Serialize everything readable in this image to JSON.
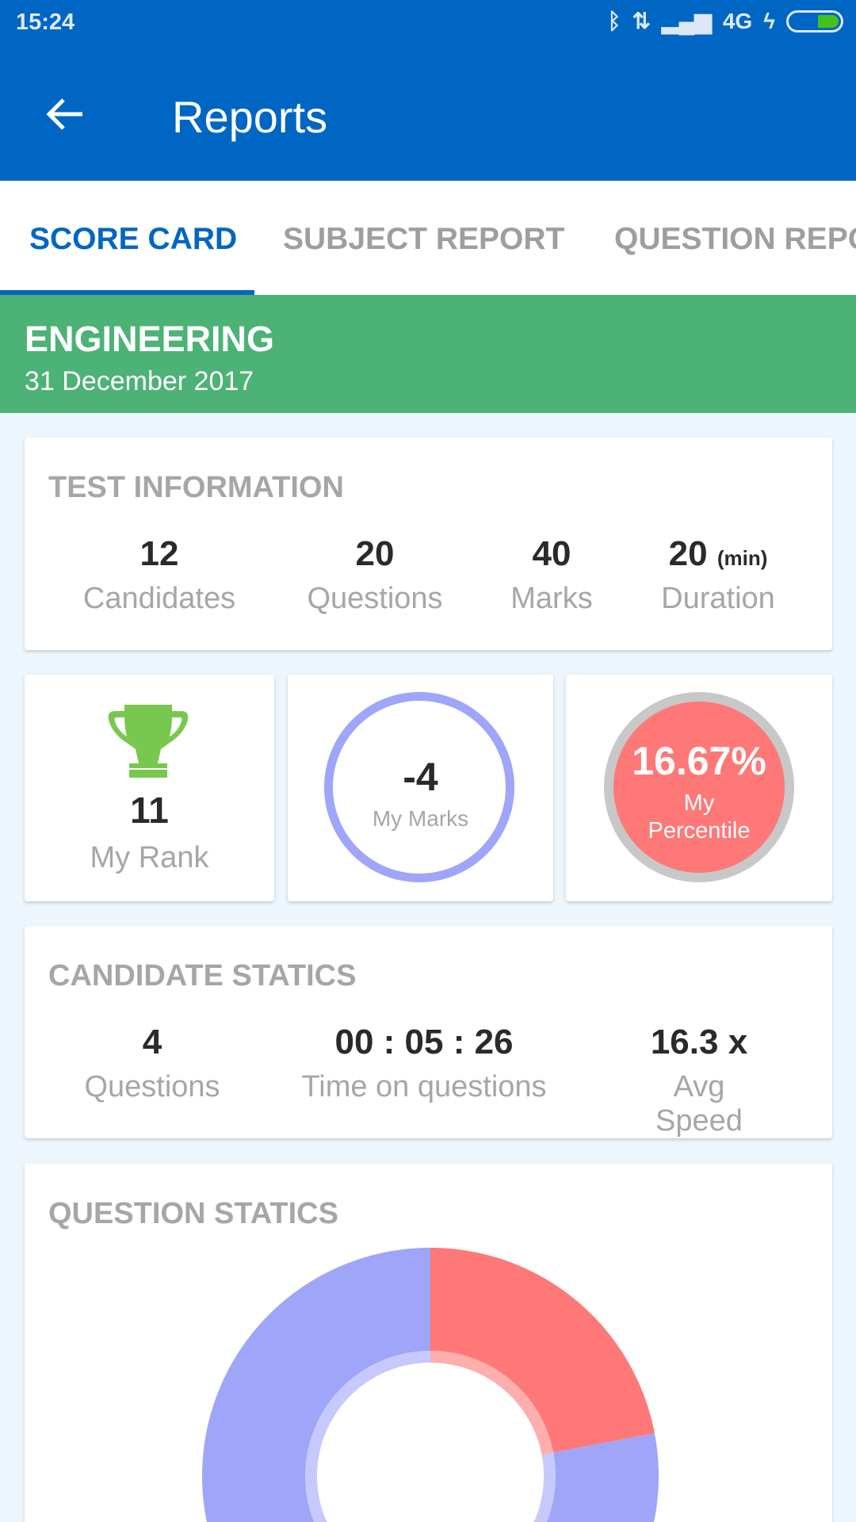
{
  "status_bar": {
    "time": "15:24",
    "network": "4G",
    "icons": [
      "bluetooth-icon",
      "data-transfer-icon",
      "signal-icon",
      "charging-icon",
      "battery-icon"
    ],
    "battery_level": 0.4
  },
  "header": {
    "title": "Reports",
    "back_icon": "arrow-left-icon"
  },
  "tabs": [
    {
      "label": "SCORE CARD",
      "active": true
    },
    {
      "label": "SUBJECT REPORT"
    },
    {
      "label": "QUESTION REPORT"
    }
  ],
  "banner": {
    "title": "ENGINEERING",
    "date": "31 December 2017"
  },
  "test_info": {
    "title": "TEST INFORMATION",
    "stats": [
      {
        "value": "12",
        "label": "Candidates"
      },
      {
        "value": "20",
        "label": "Questions"
      },
      {
        "value": "40",
        "label": "Marks"
      },
      {
        "value": "20",
        "unit": "(min)",
        "label": "Duration"
      }
    ]
  },
  "rank": {
    "value": "11",
    "label": "My Rank",
    "icon": "trophy-icon"
  },
  "marks": {
    "value": "-4",
    "label": "My Marks"
  },
  "percentile": {
    "value": "16.67%",
    "label_line1": "My",
    "label_line2": "Percentile"
  },
  "candidate_stats": {
    "title": "CANDIDATE STATICS",
    "stats": [
      {
        "value": "4",
        "label": "Questions"
      },
      {
        "value": "00 : 05 : 26",
        "label": "Time on questions"
      },
      {
        "value": "16.3 x",
        "label": "Avg Speed"
      }
    ]
  },
  "colors": {
    "primary": "#0066C4",
    "banner": "#4CB276",
    "red": "#FF7878",
    "blue": "#9FA5F8",
    "trophy": "#78C850"
  },
  "chart_data": {
    "type": "pie",
    "title": "QUESTION STATICS",
    "donut": true,
    "slices": [
      {
        "percent": 22,
        "color": "#FF7878"
      },
      {
        "percent": 78,
        "color": "#9FA5F8"
      }
    ]
  }
}
